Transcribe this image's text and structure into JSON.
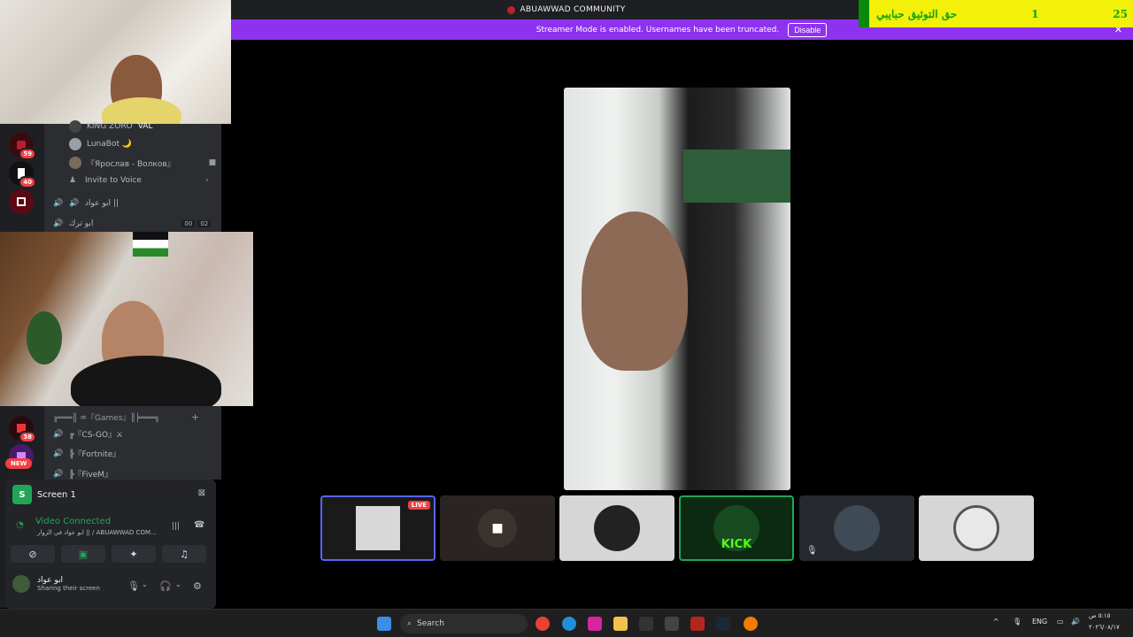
{
  "titlebar": {
    "server_name": "ABUAWWAD COMMUNITY"
  },
  "banner": {
    "message": "Streamer Mode is enabled. Usernames have been truncated.",
    "disable_label": "Disable",
    "close": "✕"
  },
  "ticker": {
    "text": "حق التوثيق حبايبي",
    "left_number": "1",
    "right_number": "25"
  },
  "servers": [
    {
      "badge": "59"
    },
    {
      "badge": "40"
    },
    {
      "badge": "38"
    }
  ],
  "new_badge": "NEW",
  "channels": {
    "voice_members": [
      {
        "name": "KING ZORO",
        "tag": "VAL"
      },
      {
        "name": "LunaBot 🌙"
      },
      {
        "name": "『Ярослав - Волков』"
      }
    ],
    "invite": "Invite to Voice",
    "voice_channels_top": [
      {
        "name": "ابو عواد ||"
      },
      {
        "name": "ابو ترك",
        "counts": [
          "00",
          "02"
        ]
      }
    ],
    "category": "╔═══║ ♒『Games』║╞═══╗",
    "voice_channels_bottom": [
      {
        "name": "╔『CS-GO』⚔"
      },
      {
        "name": "╠『Fortnite』"
      },
      {
        "name": "╠『FiveM』"
      }
    ]
  },
  "voice_panel": {
    "screen_label": "Screen 1",
    "status": "Video Connected",
    "sub": "ابو عواد في الزوار || / ABUAWWAD COM...",
    "user_name": "ابو عواد",
    "user_status": "Sharing their screen"
  },
  "tiles": {
    "live_label": "LIVE",
    "kick_label": "KICK"
  },
  "taskbar": {
    "search_label": "Search",
    "lang": "ENG",
    "time": "٥:١٥ ص",
    "date": "٢٠٢٦/٠٨/١٧"
  },
  "colors": {
    "streamer_banner": "#8f32f0",
    "ticker_bg": "#f3f00a",
    "ticker_text": "#13a113",
    "connected": "#23a559"
  }
}
